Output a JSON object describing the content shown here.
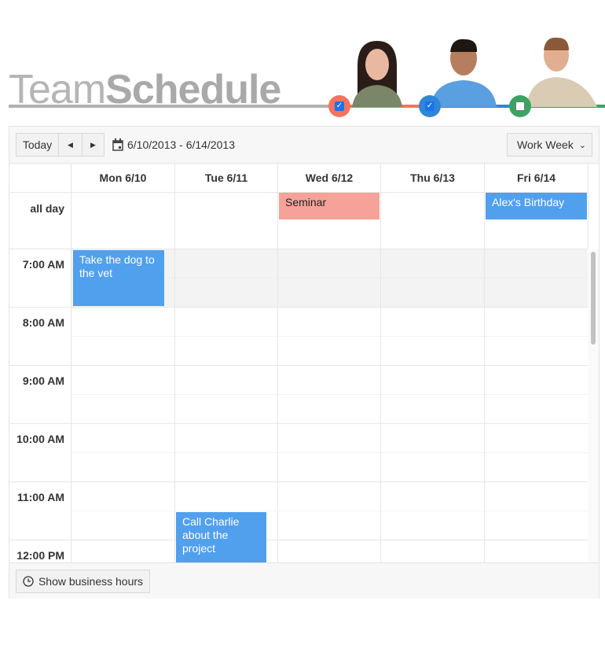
{
  "header": {
    "logo_light": "Team",
    "logo_bold": "Schedule"
  },
  "people": [
    {
      "name": "person-1",
      "color": "#f4735f",
      "checked": true
    },
    {
      "name": "person-2",
      "color": "#2f86d7",
      "checked": true
    },
    {
      "name": "person-3",
      "color": "#3aa364",
      "checked": false
    }
  ],
  "toolbar": {
    "today": "Today",
    "prev": "◀",
    "next": "▶",
    "date_range": "6/10/2013 - 6/14/2013",
    "view": "Work Week"
  },
  "days": [
    "Mon 6/10",
    "Tue 6/11",
    "Wed 6/12",
    "Thu 6/13",
    "Fri 6/14"
  ],
  "all_day_label": "all day",
  "times": [
    "7:00 AM",
    "8:00 AM",
    "9:00 AM",
    "10:00 AM",
    "11:00 AM",
    "12:00 PM"
  ],
  "events": {
    "seminar": "Seminar",
    "birthday": "Alex's Birthday",
    "dog": "Take the dog to the vet",
    "charlie": "Call Charlie about the project"
  },
  "colors": {
    "blue_event": "#51a0ed",
    "salmon_event": "#f6a298"
  },
  "footer": {
    "business_hours": "Show business hours"
  }
}
